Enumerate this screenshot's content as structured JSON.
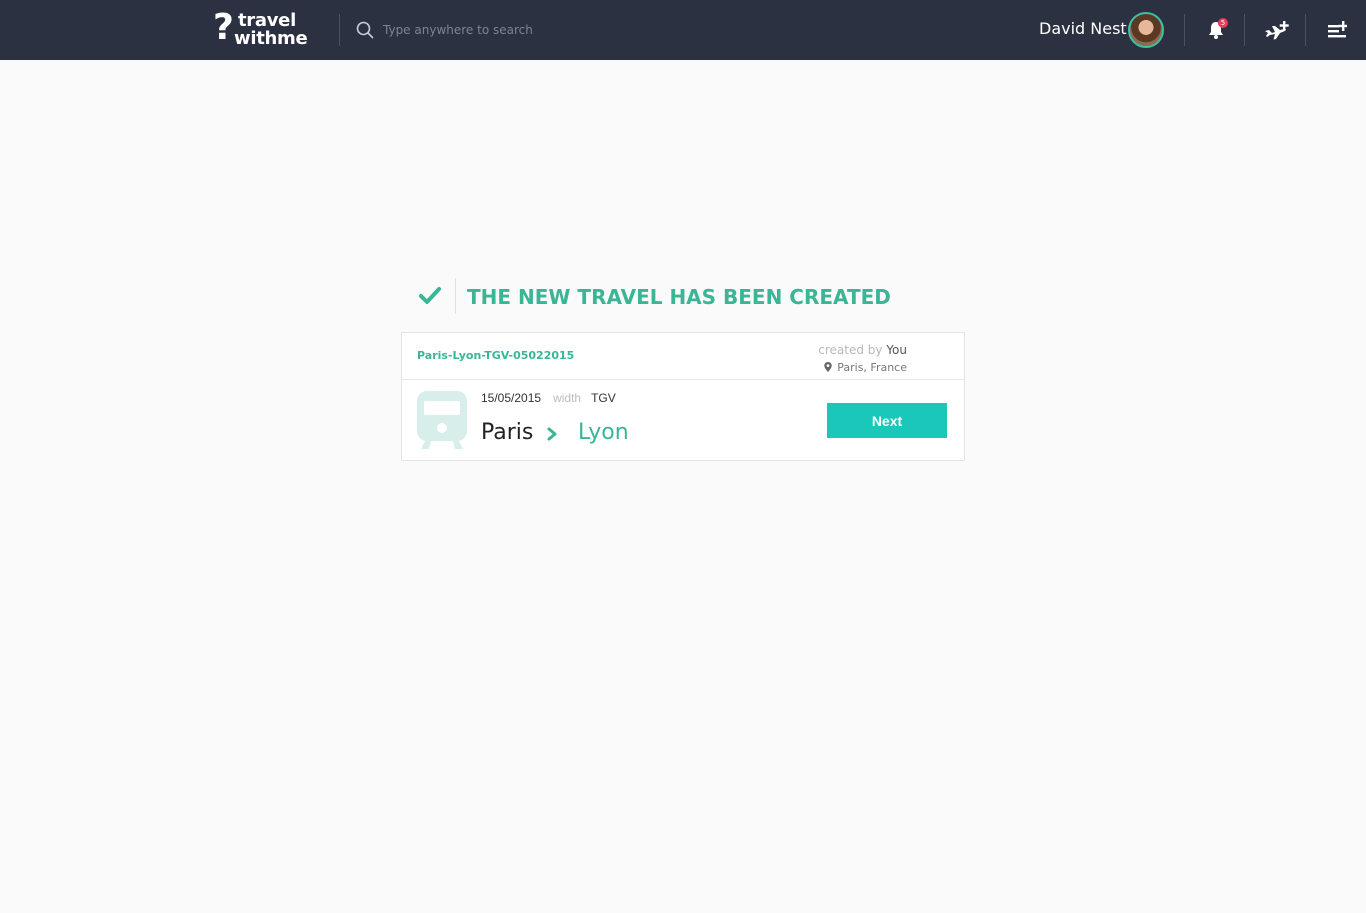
{
  "header": {
    "logo": {
      "mark": "?",
      "line1": "travel",
      "line2": "withme"
    },
    "search": {
      "placeholder": "Type anywhere to search"
    },
    "user": {
      "name": "David Nest"
    },
    "notifications": {
      "count": "5"
    }
  },
  "confirmation": {
    "title": "THE NEW TRAVEL HAS BEEN CREATED"
  },
  "travel": {
    "id": "Paris-Lyon-TGV-05022015",
    "created_by_label": "created by",
    "created_by": "You",
    "location": "Paris, France",
    "date": "15/05/2015",
    "with_label": "width",
    "transport": "TGV",
    "from": "Paris",
    "to": "Lyon",
    "next_label": "Next"
  },
  "colors": {
    "topbar": "#2b3141",
    "accent": "#3ab596",
    "button": "#1ac8b9",
    "badge": "#e83a5b"
  },
  "icons": [
    "search-icon",
    "bell-icon",
    "plane-add-icon",
    "list-add-icon",
    "check-icon",
    "pin-icon",
    "train-icon",
    "chevron-right-icon"
  ]
}
